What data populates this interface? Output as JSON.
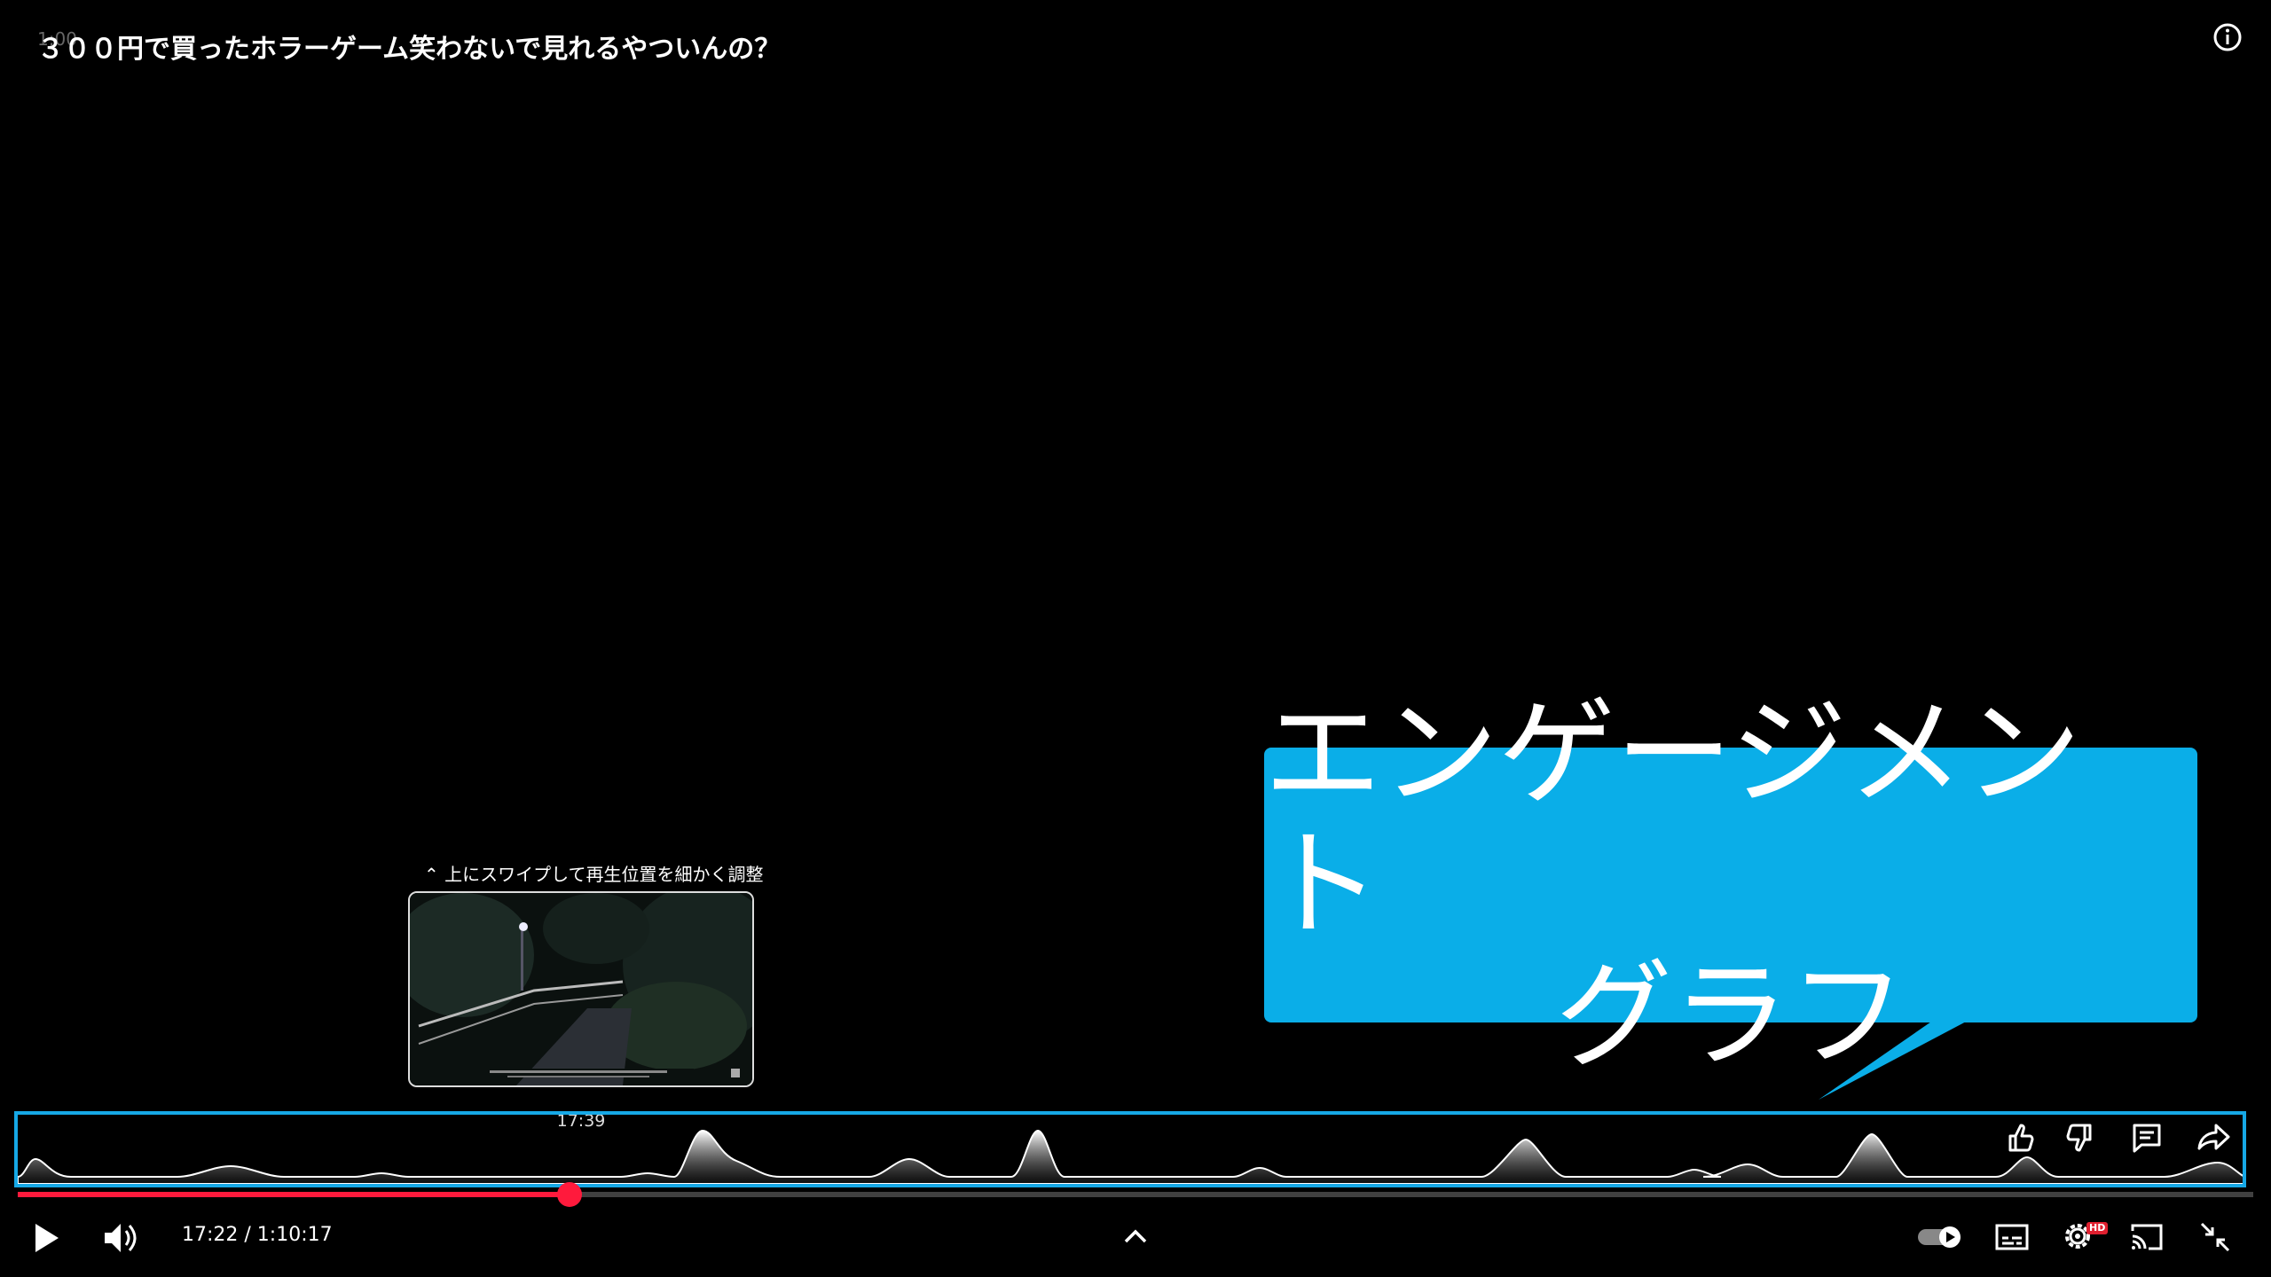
{
  "overlay": {
    "small_label": "1:00",
    "title": "３００円で買ったホラーゲーム笑わないで見れるやついんの？"
  },
  "seek_preview": {
    "hint": "⌃ 上にスワイプして再生位置を細かく調整",
    "time": "17:39"
  },
  "callout": {
    "line1": "エンゲージメント",
    "line2": "グラフ",
    "color": "#0aaee8"
  },
  "player": {
    "current_time": "17:22",
    "duration": "1:10:17",
    "time_text": "17:22 / 1:10:17",
    "progress_fraction": 0.247,
    "hd_badge": "HD",
    "accent_color": "#ff1a3c"
  },
  "icons": {
    "info": "info-icon",
    "play": "play-icon",
    "volume": "volume-icon",
    "expand": "chevron-up-icon",
    "autoplay": "autoplay-toggle-icon",
    "captions": "captions-icon",
    "settings": "gear-icon",
    "cast": "cast-icon",
    "exit_fullscreen": "exit-fullscreen-icon",
    "like": "thumbs-up-icon",
    "dislike": "thumbs-down-icon",
    "comments": "comment-icon",
    "share": "share-icon"
  }
}
